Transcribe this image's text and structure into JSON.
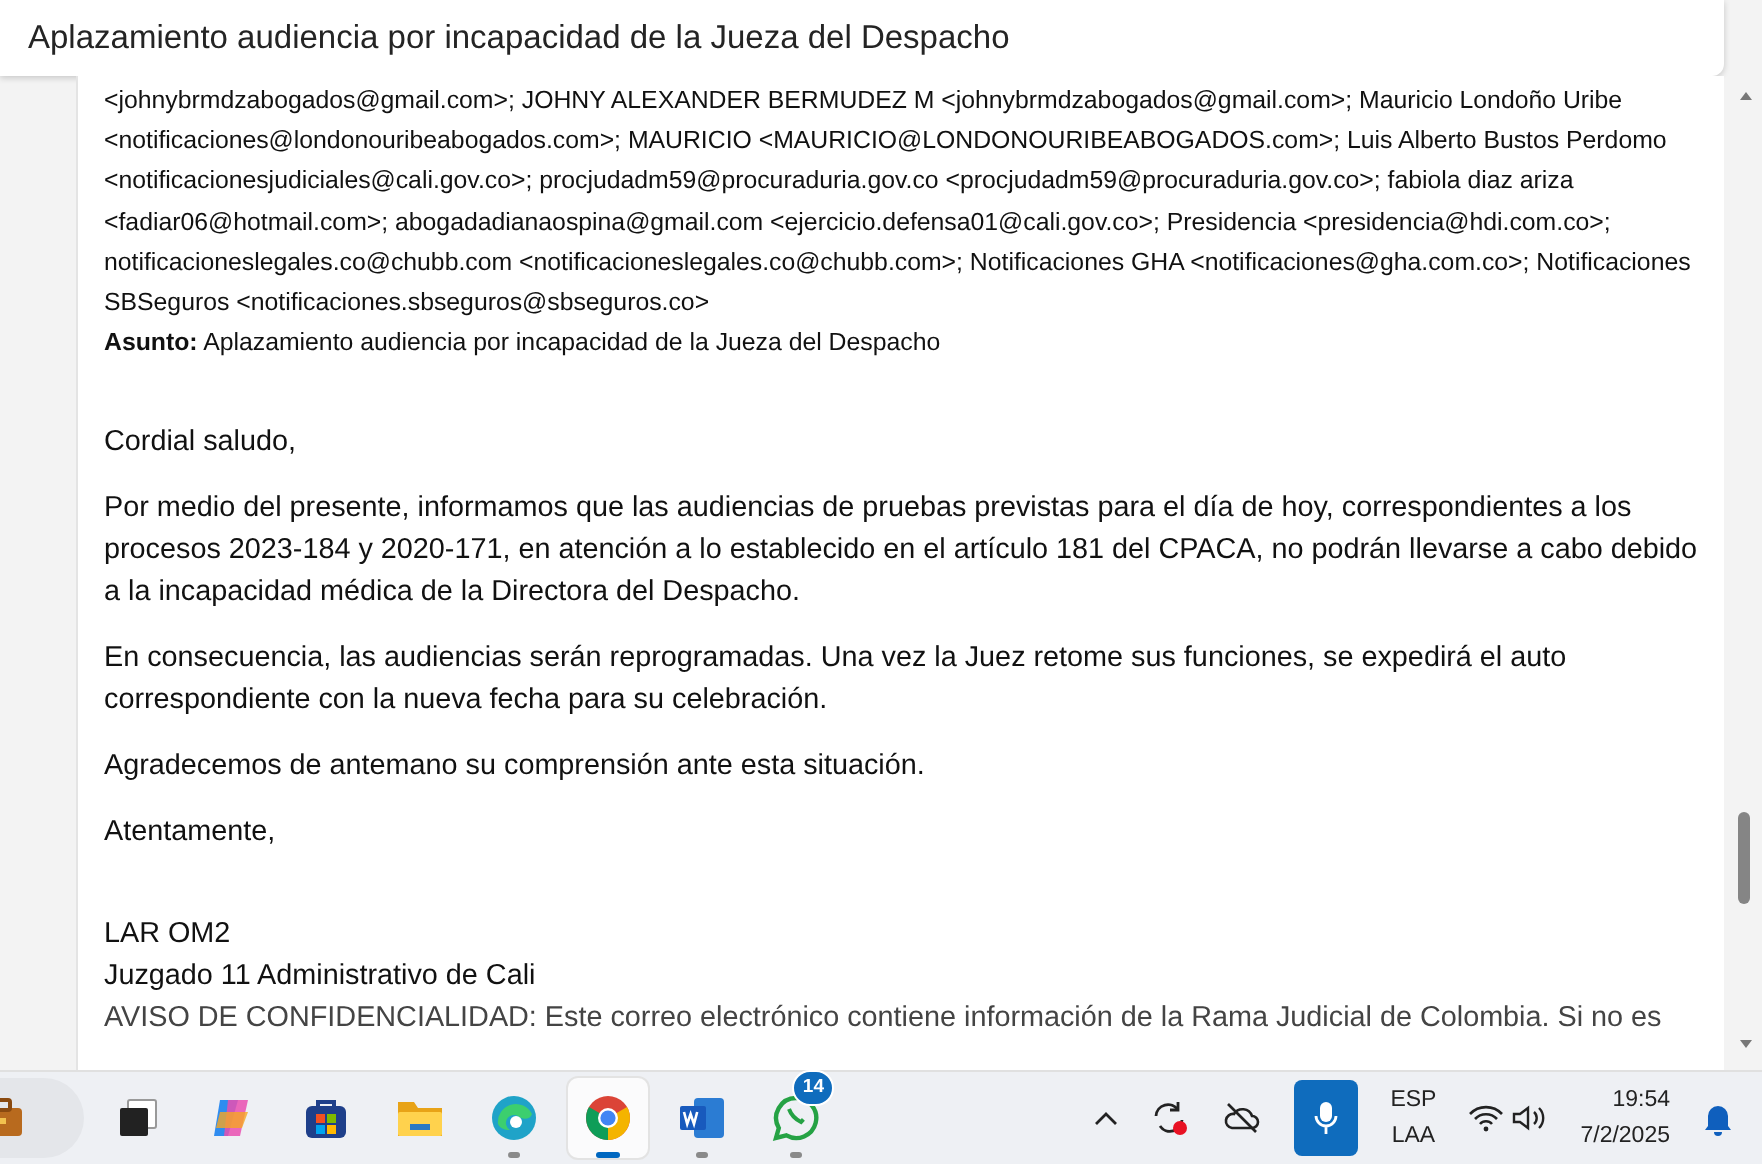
{
  "window": {
    "title": "Aplazamiento audiencia por incapacidad de la Jueza del Despacho"
  },
  "email": {
    "recipients": "<johnybrmdzabogados@gmail.com>; JOHNY ALEXANDER BERMUDEZ M <johnybrmdzabogados@gmail.com>; Mauricio Londoño Uribe <notificaciones@londonouribeabogados.com>; MAURICIO <MAURICIO@LONDONOURIBEABOGADOS.com>; Luis Alberto Bustos Perdomo <notificacionesjudiciales@cali.gov.co>; procjudadm59@procuraduria.gov.co <procjudadm59@procuraduria.gov.co>; fabiola diaz ariza <fadiar06@hotmail.com>; abogadadianaospina@gmail.com <ejercicio.defensa01@cali.gov.co>; Presidencia <presidencia@hdi.com.co>; notificacioneslegales.co@chubb.com <notificacioneslegales.co@chubb.com>; Notificaciones GHA <notificaciones@gha.com.co>; Notificaciones SBSeguros <notificaciones.sbseguros@sbseguros.co>",
    "subject": "**Asunto:** Aplazamiento audiencia por incapacidad de la Jueza del Despacho",
    "greeting": "Cordial saludo,",
    "paragraphs": [
      "Por medio del presente, informamos que las audiencias de pruebas previstas para el día de hoy, correspondientes a los procesos 2023-184 y 2020-171, en atención a lo establecido en el artículo 181 del CPACA, no podrán llevarse a cabo debido a la incapacidad médica de la Directora del Despacho.",
      "En consecuencia, las audiencias serán reprogramadas. Una vez la Juez retome sus funciones, se expedirá el auto correspondiente con la nueva fecha para su celebración.",
      "Agradecemos de antemano su comprensión ante esta situación."
    ],
    "closing": "Atentamente,",
    "signature": [
      "LAR OM2",
      "Juzgado 11 Administrativo de Cali"
    ],
    "disclaimer": "AVISO DE CONFIDENCIALIDAD: Este correo electrónico contiene información de la Rama Judicial de Colombia. Si no es"
  },
  "taskbar": {
    "apps": [
      {
        "kind": "briefcase",
        "running": false,
        "selected": false
      },
      {
        "kind": "taskview",
        "running": false,
        "selected": false
      },
      {
        "kind": "copilot",
        "running": false,
        "selected": false
      },
      {
        "kind": "store",
        "running": false,
        "selected": false
      },
      {
        "kind": "folder",
        "running": false,
        "selected": false
      },
      {
        "kind": "edge",
        "running": true,
        "selected": false
      },
      {
        "kind": "chrome",
        "running": true,
        "selected": true
      },
      {
        "kind": "word",
        "running": true,
        "selected": false
      },
      {
        "kind": "whatsapp",
        "running": true,
        "selected": false,
        "badge": "14"
      }
    ],
    "language": [
      "ESP",
      "LAA"
    ],
    "time": "19:54",
    "date": "7/2/2025"
  }
}
